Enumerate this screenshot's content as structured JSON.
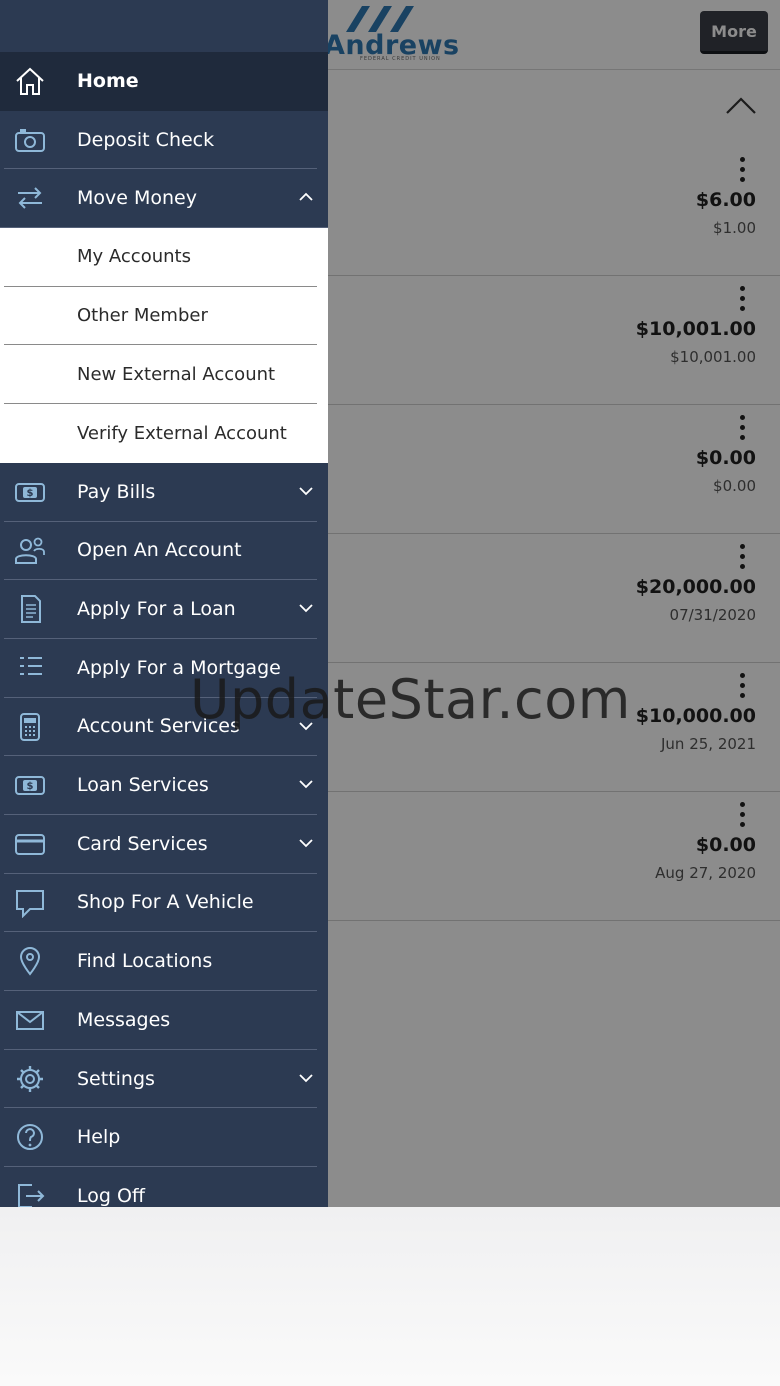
{
  "header": {
    "logo_text": "Andrews",
    "logo_subtext": "FEDERAL CREDIT UNION",
    "more_label": "More"
  },
  "accounts": [
    {
      "amount": "$6.00",
      "sub": "$1.00"
    },
    {
      "amount": "$10,001.00",
      "sub": "$10,001.00"
    },
    {
      "amount": "$0.00",
      "sub": "$0.00"
    },
    {
      "amount": "$20,000.00",
      "sub": "07/31/2020"
    },
    {
      "amount": "$10,000.00",
      "sub": "Jun 25, 2021"
    },
    {
      "amount": "$0.00",
      "sub": "Aug 27, 2020"
    }
  ],
  "menu": {
    "home": "Home",
    "deposit_check": "Deposit Check",
    "move_money": "Move Money",
    "move_money_sub": [
      "My Accounts",
      "Other Member",
      "New External Account",
      "Verify External Account"
    ],
    "pay_bills": "Pay Bills",
    "open_account": "Open An Account",
    "apply_loan": "Apply For a Loan",
    "apply_mortgage": "Apply For a Mortgage",
    "account_services": "Account Services",
    "loan_services": "Loan Services",
    "card_services": "Card Services",
    "shop_vehicle": "Shop For A Vehicle",
    "find_locations": "Find Locations",
    "messages": "Messages",
    "settings": "Settings",
    "help": "Help",
    "log_off": "Log Off"
  },
  "icons": {
    "home": "home-icon",
    "deposit_check": "camera-icon",
    "move_money": "transfer-arrows-icon",
    "pay_bills": "money-bill-icon",
    "open_account": "users-icon",
    "apply_loan": "document-icon",
    "apply_mortgage": "list-icon",
    "account_services": "calculator-icon",
    "loan_services": "money-bill-icon",
    "card_services": "credit-card-icon",
    "shop_vehicle": "chat-bubble-icon",
    "find_locations": "map-pin-icon",
    "messages": "envelope-icon",
    "settings": "gear-icon",
    "help": "question-circle-icon",
    "log_off": "logout-icon"
  },
  "watermark": "UpdateStar.com",
  "colors": {
    "drawer_bg": "#2c3a52",
    "drawer_active_bg": "#1f2a3c",
    "icon_tint": "#8fb8d8",
    "brand_blue": "#2e78b3"
  }
}
